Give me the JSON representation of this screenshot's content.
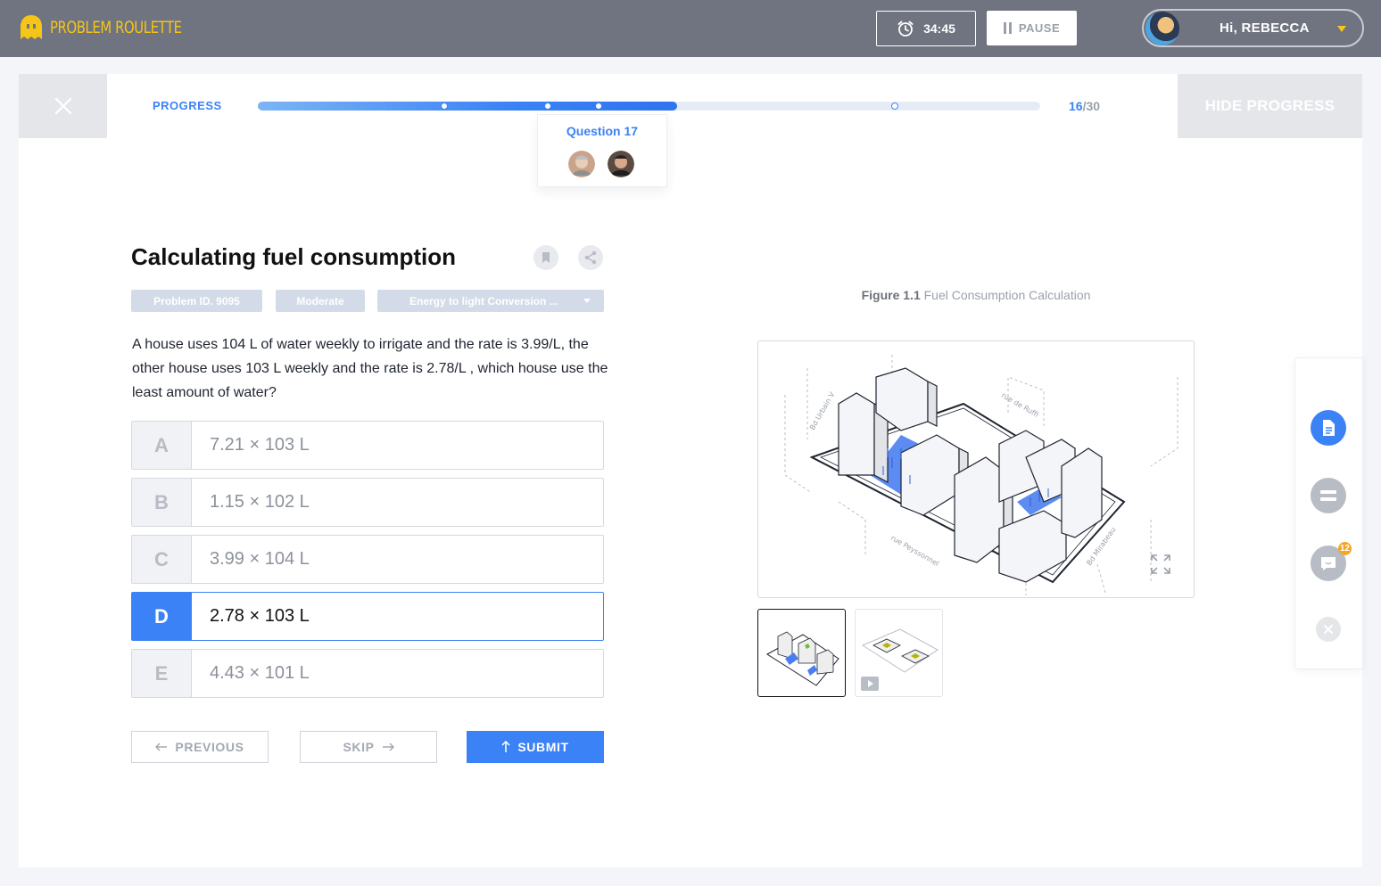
{
  "app": {
    "name": "PROBLEM ROULETTE"
  },
  "header": {
    "timer": "34:45",
    "pause_label": "PAUSE",
    "greeting": "Hi, REBECCA"
  },
  "progress": {
    "label": "PROGRESS",
    "current": "16",
    "separator": "/",
    "total": "30",
    "fraction_complete": 0.536,
    "hide_label": "HIDE PROGRESS",
    "popover_title": "Question 17"
  },
  "question": {
    "title": "Calculating fuel consumption",
    "problem_id": "Problem ID. 9095",
    "difficulty": "Moderate",
    "topic": "Energy to light Conversion ...",
    "text": "A house uses 104 L of water weekly to irrigate and the rate is 3.99/L, the other house uses 103 L weekly and the rate is 2.78/L , which house use the least amount of water?",
    "options": [
      {
        "letter": "A",
        "value": "7.21 × 103 L"
      },
      {
        "letter": "B",
        "value": "1.15 × 102 L"
      },
      {
        "letter": "C",
        "value": "3.99 × 104 L"
      },
      {
        "letter": "D",
        "value": "2.78 × 103 L"
      },
      {
        "letter": "E",
        "value": "4.43 × 101 L"
      }
    ],
    "selected": "D"
  },
  "buttons": {
    "previous": "PREVIOUS",
    "skip": "SKIP",
    "submit": "SUBMIT"
  },
  "figure": {
    "number": "Figure 1.1",
    "caption": "Fuel Consumption Calculation",
    "street_labels": [
      "Bd Urbain V",
      "rue de Ruffi",
      "rue Peyssonnel",
      "Bd Mirabeau"
    ]
  },
  "side_panel": {
    "chat_badge": "12"
  },
  "colors": {
    "accent": "#3b82f6",
    "topbar": "#6f7480",
    "logo": "#f5c518",
    "badge": "#f5a623"
  }
}
